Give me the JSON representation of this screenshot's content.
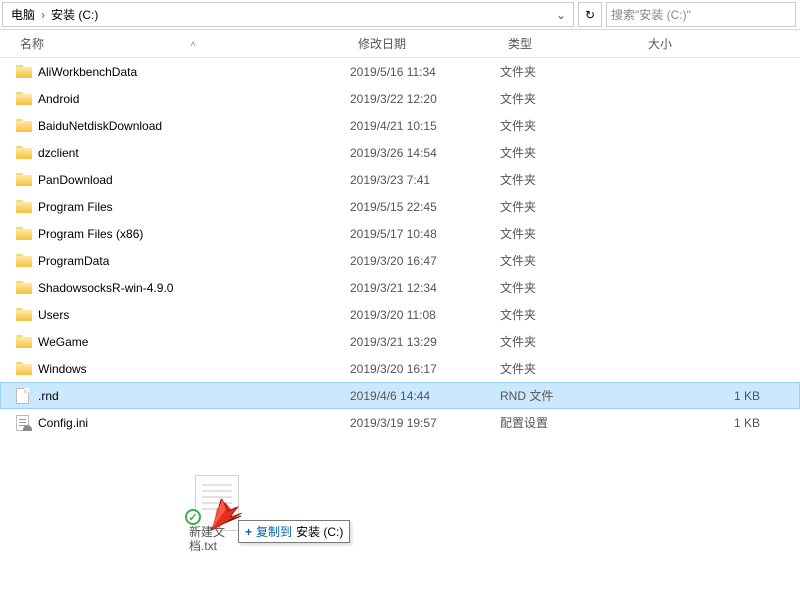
{
  "breadcrumb": {
    "seg1": "电脑",
    "seg2": "安装 (C:)"
  },
  "search": {
    "placeholder": "搜索\"安装 (C:)\""
  },
  "columns": {
    "name": "名称",
    "date": "修改日期",
    "type": "类型",
    "size": "大小"
  },
  "drag": {
    "ghost_label": "新建文\n档.txt",
    "tip_action": "复制到",
    "tip_target": "安装 (C:)"
  },
  "rows": [
    {
      "icon": "folder",
      "name": "AliWorkbenchData",
      "date": "2019/5/16 11:34",
      "type": "文件夹",
      "size": ""
    },
    {
      "icon": "folder",
      "name": "Android",
      "date": "2019/3/22 12:20",
      "type": "文件夹",
      "size": ""
    },
    {
      "icon": "folder",
      "name": "BaiduNetdiskDownload",
      "date": "2019/4/21 10:15",
      "type": "文件夹",
      "size": ""
    },
    {
      "icon": "folder",
      "name": "dzclient",
      "date": "2019/3/26 14:54",
      "type": "文件夹",
      "size": ""
    },
    {
      "icon": "folder",
      "name": "PanDownload",
      "date": "2019/3/23 7:41",
      "type": "文件夹",
      "size": ""
    },
    {
      "icon": "folder",
      "name": "Program Files",
      "date": "2019/5/15 22:45",
      "type": "文件夹",
      "size": ""
    },
    {
      "icon": "folder",
      "name": "Program Files (x86)",
      "date": "2019/5/17 10:48",
      "type": "文件夹",
      "size": ""
    },
    {
      "icon": "folder",
      "name": "ProgramData",
      "date": "2019/3/20 16:47",
      "type": "文件夹",
      "size": ""
    },
    {
      "icon": "folder",
      "name": "ShadowsocksR-win-4.9.0",
      "date": "2019/3/21 12:34",
      "type": "文件夹",
      "size": ""
    },
    {
      "icon": "folder",
      "name": "Users",
      "date": "2019/3/20 11:08",
      "type": "文件夹",
      "size": ""
    },
    {
      "icon": "folder",
      "name": "WeGame",
      "date": "2019/3/21 13:29",
      "type": "文件夹",
      "size": ""
    },
    {
      "icon": "folder",
      "name": "Windows",
      "date": "2019/3/20 16:17",
      "type": "文件夹",
      "size": ""
    },
    {
      "icon": "file",
      "name": ".rnd",
      "date": "2019/4/6 14:44",
      "type": "RND 文件",
      "size": "1 KB",
      "selected": true
    },
    {
      "icon": "ini",
      "name": "Config.ini",
      "date": "2019/3/19 19:57",
      "type": "配置设置",
      "size": "1 KB"
    }
  ]
}
